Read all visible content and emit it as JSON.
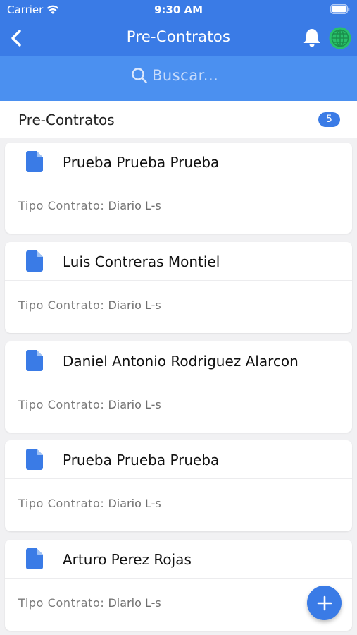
{
  "status": {
    "carrier": "Carrier",
    "time": "9:30 AM"
  },
  "nav": {
    "title": "Pre-Contratos"
  },
  "search": {
    "placeholder": "Buscar..."
  },
  "section": {
    "title": "Pre-Contratos",
    "count": "5"
  },
  "colors": {
    "primary": "#3a7be6",
    "search_bg": "#4b90f0",
    "globe": "#29c06b"
  },
  "contracts": [
    {
      "name": "Prueba Prueba Prueba",
      "type_label": "Tipo Contrato:",
      "type_value": "Diario L-s"
    },
    {
      "name": "Luis Contreras Montiel",
      "type_label": "Tipo Contrato:",
      "type_value": "Diario L-s"
    },
    {
      "name": "Daniel Antonio Rodriguez Alarcon",
      "type_label": "Tipo Contrato:",
      "type_value": "Diario L-s"
    },
    {
      "name": "Prueba Prueba Prueba",
      "type_label": "Tipo Contrato:",
      "type_value": "Diario L-s"
    },
    {
      "name": "Arturo Perez Rojas",
      "type_label": "Tipo Contrato:",
      "type_value": "Diario L-s"
    }
  ],
  "icons": {
    "back": "chevron-left-icon",
    "bell": "bell-icon",
    "globe": "globe-icon",
    "search": "search-icon",
    "document": "document-icon",
    "fab": "plus-icon"
  }
}
